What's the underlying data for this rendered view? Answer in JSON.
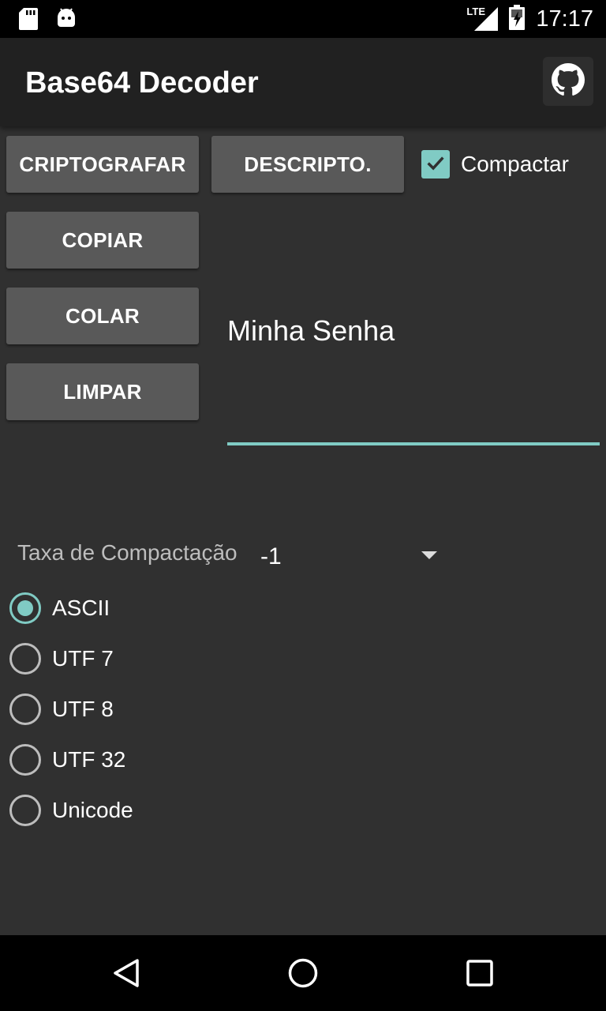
{
  "status_bar": {
    "time": "17:17",
    "network_label": "LTE",
    "icons": [
      "sd-card-icon",
      "android-icon",
      "signal-icon",
      "battery-charging-icon"
    ]
  },
  "app_bar": {
    "title": "Base64 Decoder",
    "action_icon": "github-icon"
  },
  "buttons": {
    "encrypt": "CRIPTOGRAFAR",
    "decrypt": "DESCRIPTO.",
    "copy": "COPIAR",
    "paste": "COLAR",
    "clear": "LIMPAR"
  },
  "compress_checkbox": {
    "label": "Compactar",
    "checked": true
  },
  "input": {
    "value": "Minha Senha"
  },
  "compression_rate": {
    "label": "Taxa de Compactação",
    "selected": "-1"
  },
  "encodings": [
    {
      "label": "ASCII",
      "checked": true
    },
    {
      "label": "UTF 7",
      "checked": false
    },
    {
      "label": "UTF 8",
      "checked": false
    },
    {
      "label": "UTF 32",
      "checked": false
    },
    {
      "label": "Unicode",
      "checked": false
    }
  ],
  "nav_bar": {
    "icons": [
      "back-icon",
      "home-icon",
      "recents-icon"
    ]
  },
  "colors": {
    "accent": "#80cbc4",
    "background": "#303030",
    "app_bar": "#212121",
    "button": "#595959"
  }
}
